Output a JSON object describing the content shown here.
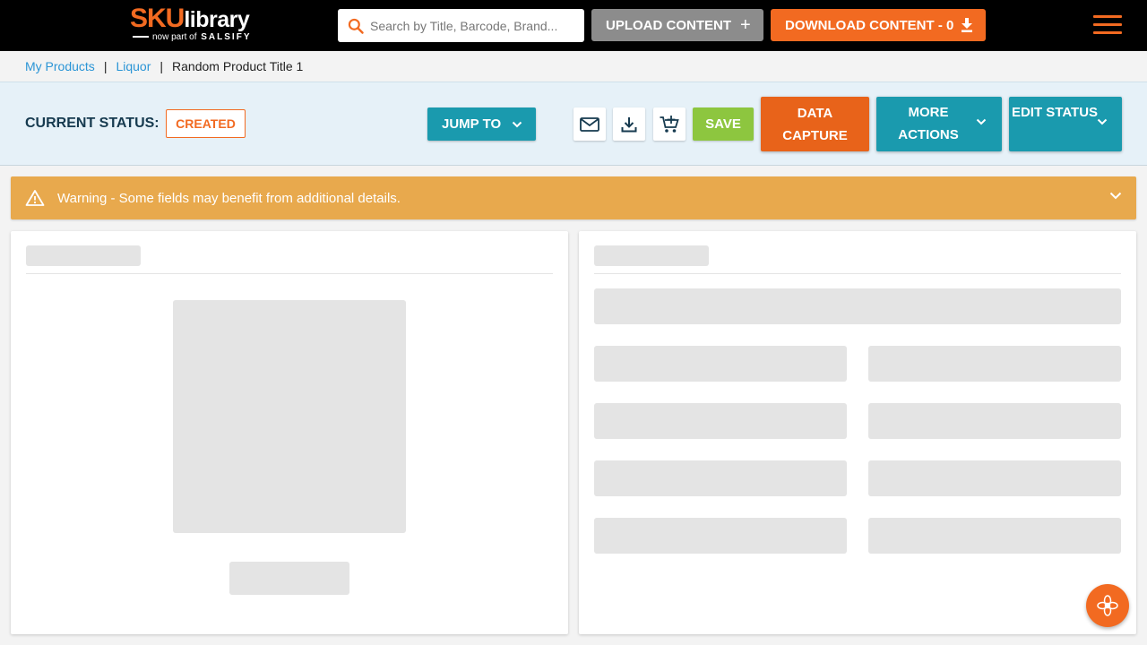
{
  "header": {
    "logo": {
      "main_a": "SKU",
      "main_b": "library",
      "sub_a": "now part of",
      "sub_b": "SALSIFY"
    },
    "search": {
      "placeholder": "Search by Title, Barcode, Brand...",
      "value": ""
    },
    "upload_label": "UPLOAD CONTENT",
    "download_label": "DOWNLOAD CONTENT - 0",
    "accent_color": "#f26a21"
  },
  "breadcrumb": {
    "items": [
      "My Products",
      "Liquor"
    ],
    "separator": "|",
    "current": "Random Product Title 1"
  },
  "status": {
    "label": "CURRENT STATUS:",
    "value": "CREATED",
    "jump_to_label": "JUMP TO",
    "save_label": "SAVE",
    "data_capture_label": "DATA CAPTURE",
    "more_actions_label": "MORE ACTIONS",
    "edit_status_label": "EDIT STATUS",
    "teal_color": "#1a9aae",
    "green_color": "#8dc63f"
  },
  "warning": {
    "text": "Warning - Some fields may benefit from additional details.",
    "color": "#e8a94d"
  },
  "icons": {
    "search": "search-icon",
    "plus": "plus-icon",
    "download": "download-icon",
    "menu": "hamburger-menu-icon",
    "email": "email-icon",
    "cart": "add-to-cart-icon",
    "chevron": "chevron-down-icon",
    "warning": "warning-triangle-icon",
    "help": "help-flower-icon"
  }
}
